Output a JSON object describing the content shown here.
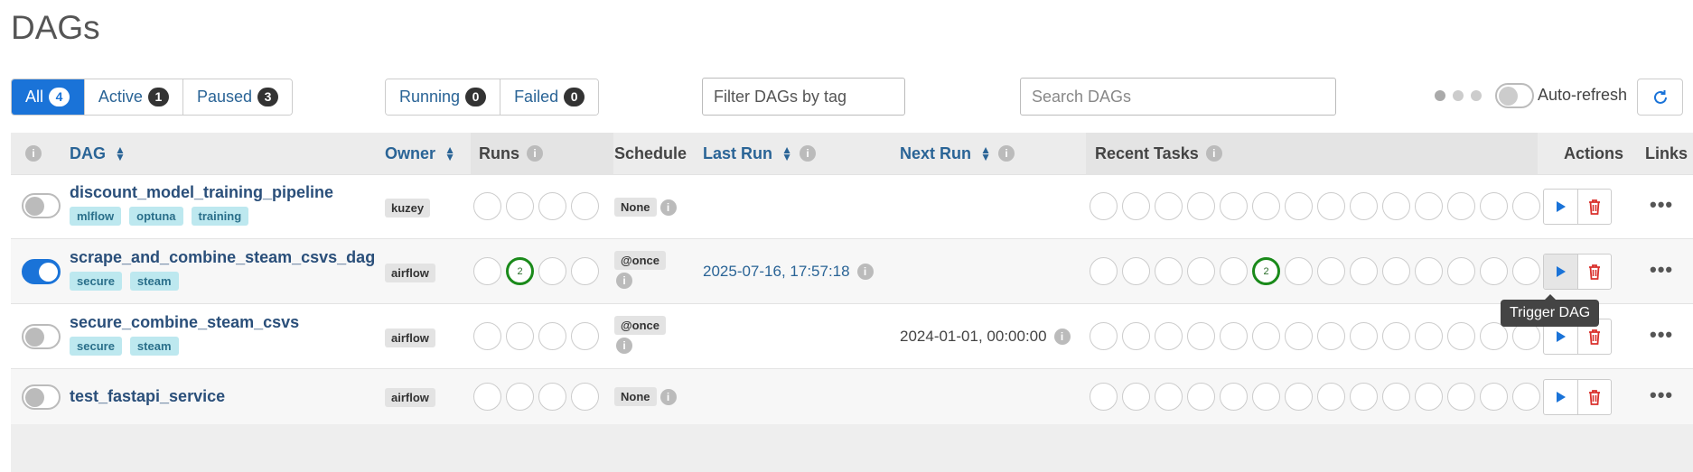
{
  "page": {
    "title": "DAGs"
  },
  "status_filters": [
    {
      "label": "All",
      "count": "4",
      "active": true
    },
    {
      "label": "Active",
      "count": "1"
    },
    {
      "label": "Paused",
      "count": "3"
    }
  ],
  "run_filters": [
    {
      "label": "Running",
      "count": "0"
    },
    {
      "label": "Failed",
      "count": "0"
    }
  ],
  "tag_filter": {
    "placeholder": "Filter DAGs by tag"
  },
  "search": {
    "placeholder": "Search DAGs"
  },
  "auto_refresh": {
    "label": "Auto-refresh",
    "enabled": false
  },
  "icons": {
    "refresh": "refresh-icon",
    "info": "info-icon",
    "sort": "sort-icon",
    "play": "play-icon",
    "delete": "trash-icon",
    "more": "more-icon"
  },
  "colors": {
    "primary": "#1a73d8",
    "link": "#2a4f7a",
    "tag_bg": "#bde8ef",
    "running": "#1a8a1a",
    "delete": "#d9302c"
  },
  "columns": {
    "dag": "DAG",
    "owner": "Owner",
    "runs": "Runs",
    "schedule": "Schedule",
    "last_run": "Last Run",
    "next_run": "Next Run",
    "recent_tasks": "Recent Tasks",
    "actions": "Actions",
    "links": "Links"
  },
  "info_glyph": "i",
  "more_glyph": "•••",
  "tooltip": {
    "text": "Trigger DAG"
  },
  "rows": [
    {
      "name": "discount_model_training_pipeline",
      "active": false,
      "tags": [
        "mlflow",
        "optuna",
        "training"
      ],
      "owner": "kuzey",
      "runs": [
        "",
        "",
        "",
        ""
      ],
      "schedule": "None",
      "last_run": "",
      "next_run": "",
      "recent_tasks": [
        "",
        "",
        "",
        "",
        "",
        "",
        "",
        "",
        "",
        "",
        "",
        "",
        "",
        "",
        ""
      ]
    },
    {
      "name": "scrape_and_combine_steam_csvs_dag",
      "active": true,
      "tags": [
        "secure",
        "steam"
      ],
      "owner": "airflow",
      "runs": [
        "",
        "2",
        "",
        ""
      ],
      "schedule": "@once",
      "last_run": "2025-07-16, 17:57:18",
      "next_run": "",
      "recent_tasks": [
        "",
        "",
        "",
        "",
        "",
        "2",
        "",
        "",
        "",
        "",
        "",
        "",
        "",
        "",
        ""
      ]
    },
    {
      "name": "secure_combine_steam_csvs",
      "active": false,
      "tags": [
        "secure",
        "steam"
      ],
      "owner": "airflow",
      "runs": [
        "",
        "",
        "",
        ""
      ],
      "schedule": "@once",
      "last_run": "",
      "next_run": "2024-01-01, 00:00:00",
      "recent_tasks": [
        "",
        "",
        "",
        "",
        "",
        "",
        "",
        "",
        "",
        "",
        "",
        "",
        "",
        "",
        ""
      ]
    },
    {
      "name": "test_fastapi_service",
      "active": false,
      "tags": [],
      "owner": "airflow",
      "runs": [
        "",
        "",
        "",
        ""
      ],
      "schedule": "None",
      "last_run": "",
      "next_run": "",
      "recent_tasks": [
        "",
        "",
        "",
        "",
        "",
        "",
        "",
        "",
        "",
        "",
        "",
        "",
        "",
        "",
        ""
      ]
    }
  ]
}
